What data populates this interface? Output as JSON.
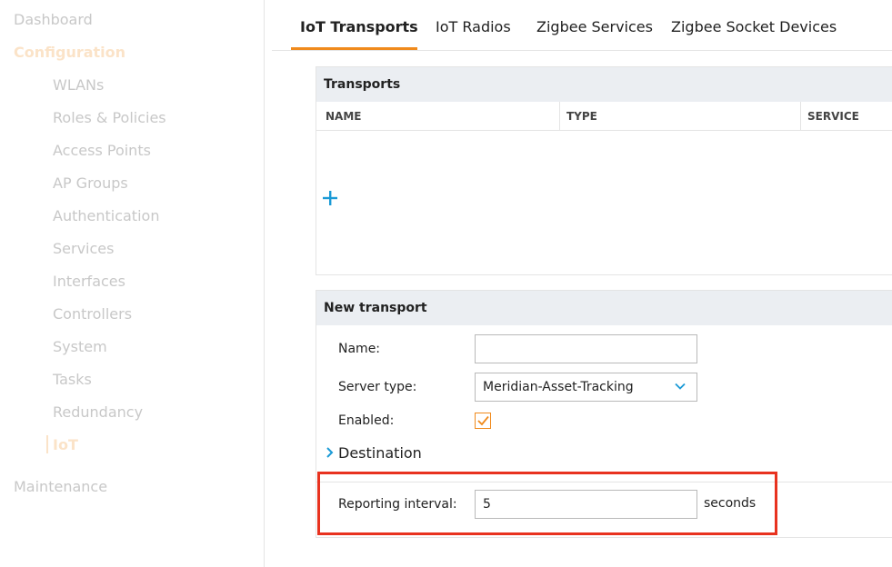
{
  "sidebar": {
    "dashboard": "Dashboard",
    "configuration": "Configuration",
    "items": [
      "WLANs",
      "Roles & Policies",
      "Access Points",
      "AP Groups",
      "Authentication",
      "Services",
      "Interfaces",
      "Controllers",
      "System",
      "Tasks",
      "Redundancy",
      "IoT"
    ],
    "active_item": "IoT",
    "maintenance": "Maintenance"
  },
  "tabs": [
    {
      "label": "IoT Transports",
      "active": true
    },
    {
      "label": "IoT Radios",
      "active": false
    },
    {
      "label": "Zigbee Services",
      "active": false
    },
    {
      "label": "Zigbee Socket Devices",
      "active": false
    }
  ],
  "transports": {
    "title": "Transports",
    "columns": [
      "NAME",
      "TYPE",
      "SERVICE"
    ],
    "rows": [],
    "add_icon": "plus-icon"
  },
  "new_transport": {
    "title": "New transport",
    "name_label": "Name:",
    "name_value": "",
    "server_type_label": "Server type:",
    "server_type_value": "Meridian-Asset-Tracking",
    "enabled_label": "Enabled:",
    "enabled": true,
    "destination_label": "Destination",
    "reporting_interval_label": "Reporting interval:",
    "reporting_interval_value": "5",
    "reporting_interval_unit": "seconds"
  },
  "colors": {
    "accent": "#f08a1c",
    "link": "#1a9ad6",
    "highlight": "#e8321f",
    "header_bg": "#ebeef2"
  }
}
